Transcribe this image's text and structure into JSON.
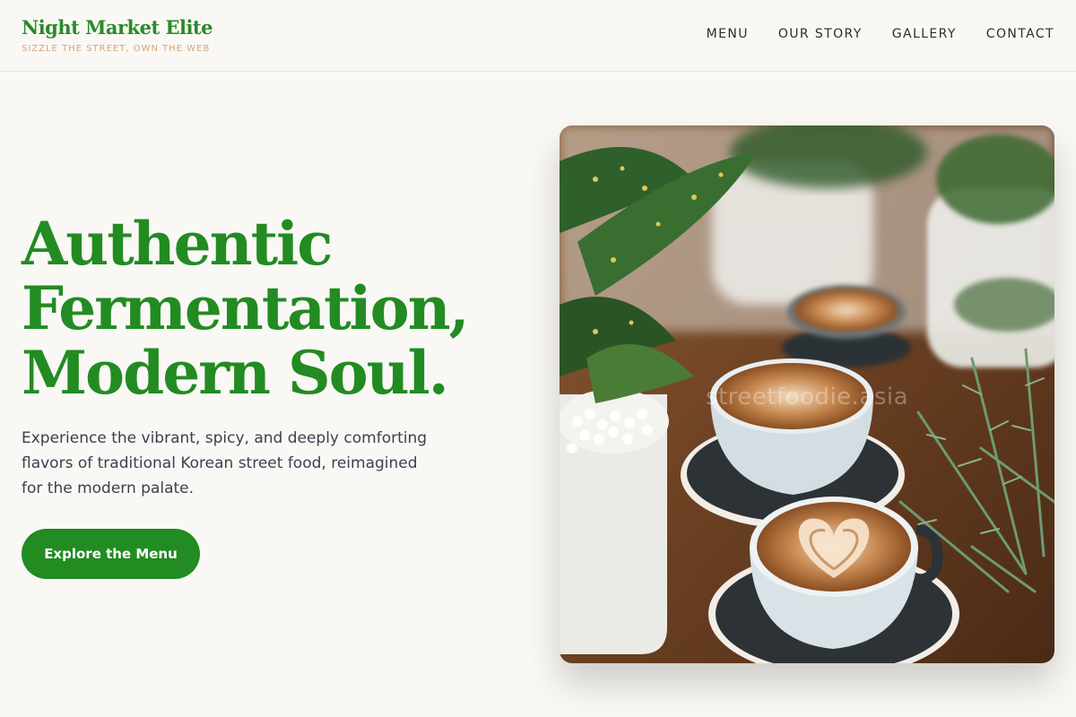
{
  "brand": {
    "name": "Night Market Elite",
    "tagline": "SIZZLE THE STREET, OWN THE WEB"
  },
  "nav": {
    "items": [
      {
        "label": "MENU"
      },
      {
        "label": "OUR STORY"
      },
      {
        "label": "GALLERY"
      },
      {
        "label": "CONTACT"
      }
    ]
  },
  "hero": {
    "title_lines": [
      "Authentic",
      "Fermentation,",
      "Modern Soul."
    ],
    "description": "Experience the vibrant, spicy, and deeply comforting flavors of traditional Korean street food, reimagined for the modern palate.",
    "cta_label": "Explore the Menu",
    "image": {
      "subject": "latte cups with heart latte art on a wooden table surrounded by potted plants",
      "watermark": "streetfoodie.asia"
    }
  },
  "colors": {
    "brand_green": "#228b22",
    "accent_tan": "#d4a574",
    "background": "#faf8f5",
    "text": "#3a4150"
  }
}
